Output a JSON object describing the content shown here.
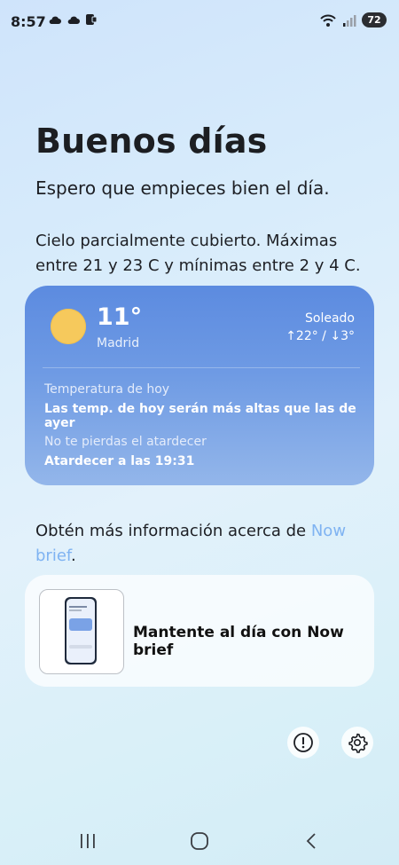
{
  "status_bar": {
    "time": "8:57",
    "battery": "72",
    "icons": [
      "cloud-icon",
      "cloud-icon",
      "app-notification-icon",
      "wifi-icon",
      "signal-icon",
      "battery-icon"
    ]
  },
  "briefing": {
    "greeting": "Buenos días",
    "subtitle": "Espero que empieces bien el día.",
    "forecast": "Cielo parcialmente cubierto. Máximas entre 21 y 23 C y mínimas entre 2 y 4 C."
  },
  "weather_card": {
    "temperature": "11°",
    "city": "Madrid",
    "condition": "Soleado",
    "minmax": "↑22° / ↓3°",
    "sections": [
      {
        "label": "Temperatura de hoy",
        "value": "Las temp. de hoy serán más altas que las de ayer"
      },
      {
        "label": "No te pierdas el atardecer",
        "value": "Atardecer a las 19:31"
      }
    ],
    "colors": {
      "sun": "#f6c95c",
      "card_top": "#5c8be0",
      "card_bottom": "#93b6ea"
    }
  },
  "more_info": {
    "text": "Obtén más información acerca de ",
    "link": "Now brief",
    "suffix": "."
  },
  "promo": {
    "title": "Mantente al día con Now brief"
  },
  "actions": {
    "info_icon": "info-icon",
    "settings_icon": "gear-icon"
  },
  "nav": {
    "items": [
      "recent-apps-icon",
      "home-icon",
      "back-icon"
    ]
  }
}
